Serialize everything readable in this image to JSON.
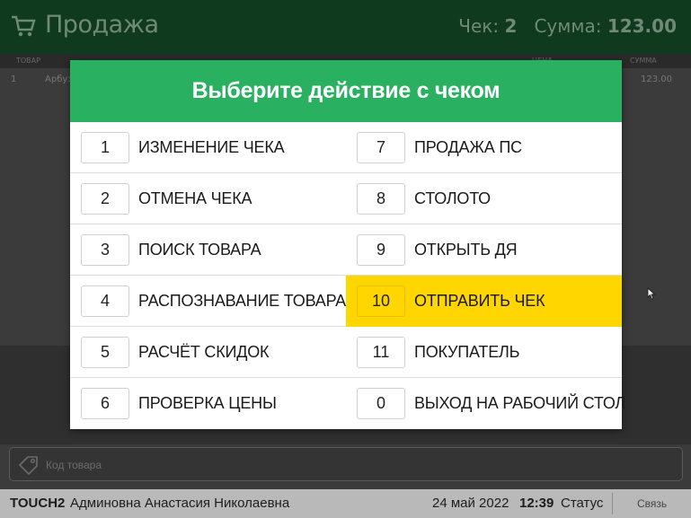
{
  "header": {
    "title": "Продажа",
    "check_label": "Чек:",
    "check_number": "2",
    "sum_label": "Сумма:",
    "sum_value": "123.00"
  },
  "table": {
    "columns": [
      "ТОВАР",
      "ЦЕНА",
      "СУММА"
    ],
    "rows": [
      {
        "num": "1",
        "name": "Арбуз",
        "sum": "123.00"
      }
    ]
  },
  "modal": {
    "title": "Выберите действие с чеком",
    "options": [
      {
        "key": "1",
        "label": "ИЗМЕНЕНИЕ ЧЕКА"
      },
      {
        "key": "2",
        "label": "ОТМЕНА ЧЕКА"
      },
      {
        "key": "3",
        "label": "ПОИСК ТОВАРА"
      },
      {
        "key": "4",
        "label": "РАСПОЗНАВАНИЕ ТОВАРА"
      },
      {
        "key": "5",
        "label": "РАСЧЁТ СКИДОК"
      },
      {
        "key": "6",
        "label": "ПРОВЕРКА ЦЕНЫ"
      },
      {
        "key": "7",
        "label": "ПРОДАЖА ПС"
      },
      {
        "key": "8",
        "label": "СТОЛОТО"
      },
      {
        "key": "9",
        "label": "ОТКРЫТЬ ДЯ"
      },
      {
        "key": "10",
        "label": "ОТПРАВИТЬ ЧЕК"
      },
      {
        "key": "11",
        "label": "ПОКУПАТЕЛЬ"
      },
      {
        "key": "0",
        "label": "ВЫХОД НА РАБОЧИЙ СТОЛ"
      }
    ],
    "highlighted_key": "10"
  },
  "search": {
    "placeholder": "Код товара",
    "icon": "tag-icon"
  },
  "statusbar": {
    "terminal": "TOUCH2",
    "user": "Админовна Анастасия Николаевна",
    "date": "24 май 2022",
    "time": "12:39",
    "status": "Статус",
    "link": "Связь"
  },
  "colors": {
    "modal_header": "#2ab061",
    "highlight": "#ffd600",
    "header_bg": "#0f3a1e",
    "statusbar_bg": "#b9b9b9"
  }
}
